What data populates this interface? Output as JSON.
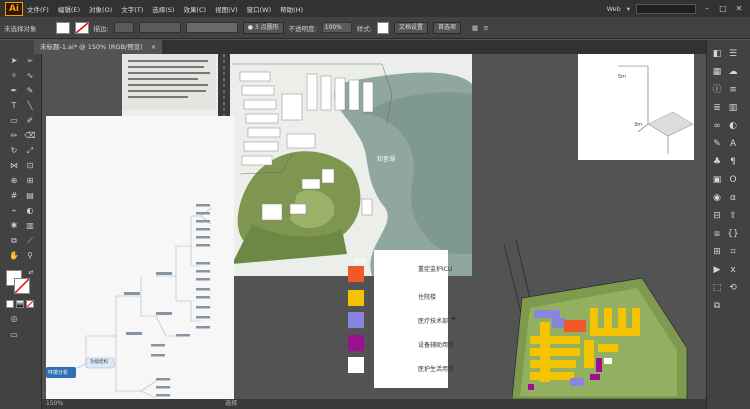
{
  "app": {
    "logo": "Ai"
  },
  "menu": [
    "文件(F)",
    "编辑(E)",
    "对象(O)",
    "文字(T)",
    "选择(S)",
    "效果(C)",
    "视图(V)",
    "窗口(W)",
    "帮助(H)"
  ],
  "workspace": "Web",
  "control": {
    "selection": "未选择对象",
    "stroke_label": "描边:",
    "brush": "3 点圆形",
    "opacity_label": "不透明度:",
    "opacity": "100%",
    "style_label": "样式:",
    "doc_setup": "文档设置",
    "prefs": "首选项"
  },
  "tab": {
    "title": "未标题-1.ai* @ 150% (RGB/预览)"
  },
  "legend": {
    "items": [
      {
        "label": "重症监护ICU",
        "color": "#f05a28"
      },
      {
        "label": "住院楼",
        "color": "#f5c400"
      },
      {
        "label": "医疗技术部",
        "color": "#8a84e0"
      },
      {
        "label": "设备辅助用房",
        "color": "#9b108f"
      },
      {
        "label": "医护生活用房",
        "color": "#ffffff"
      }
    ]
  },
  "map": {
    "label_lake": "知音湖",
    "label_site": "基地"
  },
  "mindmap": {
    "root": "环境分析",
    "center": "功能结构"
  },
  "status": {
    "zoom": "150%",
    "tool": "选择"
  },
  "sketch": {
    "label1": "5m",
    "label2": "3m"
  }
}
